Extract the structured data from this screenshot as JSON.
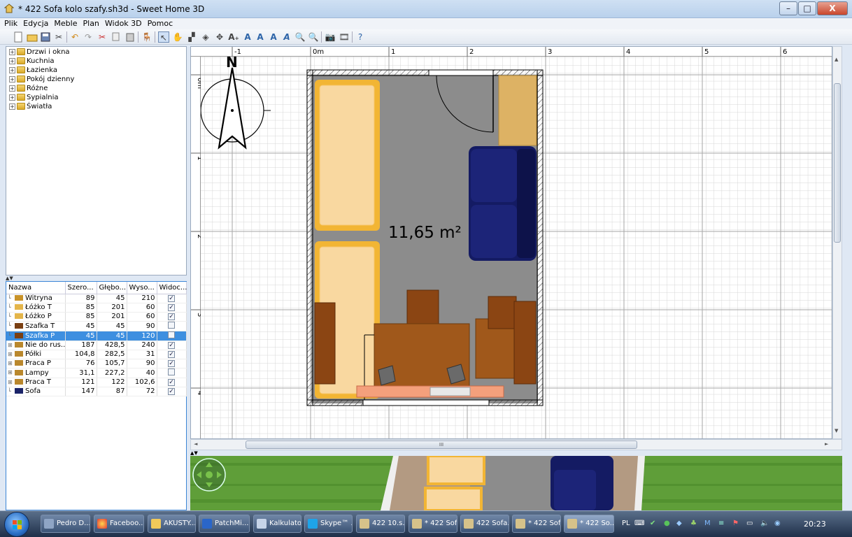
{
  "window": {
    "title": "* 422 Sofa kolo szafy.sh3d - Sweet Home 3D",
    "controls": {
      "minimize": "–",
      "maximize": "□",
      "close": "X"
    }
  },
  "menu": [
    "Plik",
    "Edycja",
    "Meble",
    "Plan",
    "Widok 3D",
    "Pomoc"
  ],
  "toolbar": {
    "icons": [
      "new-file-icon",
      "open-file-icon",
      "save-file-icon",
      "preferences-icon",
      "undo-icon",
      "redo-icon",
      "cut-icon",
      "copy-icon",
      "paste-icon",
      "add-furniture-icon",
      "select-mode-icon",
      "pan-mode-icon",
      "create-walls-icon",
      "create-rooms-icon",
      "create-dimensions-icon",
      "add-text-icon",
      "increase-text-icon",
      "decrease-text-icon",
      "bold-text-icon",
      "italic-text-icon",
      "zoom-in-icon",
      "zoom-out-icon",
      "create-photo-icon",
      "create-video-icon",
      "help-icon"
    ]
  },
  "catalog": {
    "categories": [
      "Drzwi i okna",
      "Kuchnia",
      "Łazienka",
      "Pokój dzienny",
      "Różne",
      "Sypialnia",
      "Światła"
    ]
  },
  "furniture_table": {
    "columns": [
      "Nazwa",
      "Szero...",
      "Głębo...",
      "Wyso...",
      "Widoc..."
    ],
    "rows": [
      {
        "name": "Witryna",
        "width": "89",
        "depth": "45",
        "height": "210",
        "visible": true,
        "group": false,
        "selected": false,
        "color": "#c8922a"
      },
      {
        "name": "Łóżko T",
        "width": "85",
        "depth": "201",
        "height": "60",
        "visible": true,
        "group": false,
        "selected": false,
        "color": "#e4b54a"
      },
      {
        "name": "Łóżko P",
        "width": "85",
        "depth": "201",
        "height": "60",
        "visible": true,
        "group": false,
        "selected": false,
        "color": "#e4b54a"
      },
      {
        "name": "Szafka T",
        "width": "45",
        "depth": "45",
        "height": "90",
        "visible": false,
        "group": false,
        "selected": false,
        "color": "#7a3f12"
      },
      {
        "name": "Szafka P",
        "width": "45",
        "depth": "45",
        "height": "120",
        "visible": false,
        "group": false,
        "selected": true,
        "color": "#7a3f12"
      },
      {
        "name": "Nie do rus...",
        "width": "187",
        "depth": "428,5",
        "height": "240",
        "visible": true,
        "group": true,
        "selected": false,
        "color": "#b9872c"
      },
      {
        "name": "Półki",
        "width": "104,8",
        "depth": "282,5",
        "height": "31",
        "visible": true,
        "group": true,
        "selected": false,
        "color": "#b9872c"
      },
      {
        "name": "Praca P",
        "width": "76",
        "depth": "105,7",
        "height": "90",
        "visible": true,
        "group": true,
        "selected": false,
        "color": "#b9872c"
      },
      {
        "name": "Lampy",
        "width": "31,1",
        "depth": "227,2",
        "height": "40",
        "visible": false,
        "group": true,
        "selected": false,
        "color": "#b9872c"
      },
      {
        "name": "Praca T",
        "width": "121",
        "depth": "122",
        "height": "102,6",
        "visible": true,
        "group": true,
        "selected": false,
        "color": "#b9872c"
      },
      {
        "name": "Sofa",
        "width": "147",
        "depth": "87",
        "height": "72",
        "visible": true,
        "group": false,
        "selected": false,
        "color": "#1a2368"
      }
    ]
  },
  "plan": {
    "ruler_top": [
      "-1",
      "0m",
      "1",
      "2",
      "3",
      "4",
      "5",
      "6"
    ],
    "ruler_left": [
      "0m",
      "1",
      "2",
      "3",
      "4"
    ],
    "compass_label": "N",
    "room_area": "11,65 m²",
    "colors": {
      "floor": "#8c8c8c",
      "bed": "#f9d8a0",
      "bed_frame": "#f2b534",
      "sofa": "#141b63",
      "wood": "#a0581b",
      "wood_dark": "#7a3f0f",
      "radiator": "#f4a07c",
      "cabinet": "#ddb264"
    },
    "hscroll_label": "III"
  },
  "taskbar": {
    "items": [
      "Pedro D...",
      "Faceboo...",
      "AKUSTY...",
      "PatchMi...",
      "Kalkulator",
      "Skype™ ...",
      "422 10.s...",
      "* 422 Sof...",
      "422 Sofa...",
      "* 422 Sof...",
      "* 422 So..."
    ],
    "language": "PL",
    "clock": "20:23"
  }
}
